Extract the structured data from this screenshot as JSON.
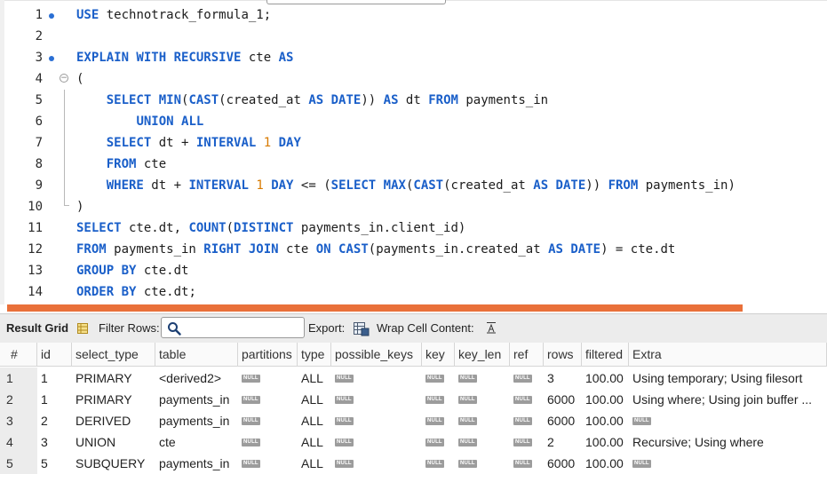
{
  "editor": {
    "lines": [
      {
        "n": "1",
        "dot": true,
        "fold": false,
        "tokens": [
          [
            "kw",
            "USE"
          ],
          [
            "t",
            " technotrack_formula_1;"
          ]
        ]
      },
      {
        "n": "2",
        "dot": false,
        "fold": false,
        "tokens": []
      },
      {
        "n": "3",
        "dot": true,
        "fold": false,
        "tokens": [
          [
            "kw",
            "EXPLAIN WITH RECURSIVE"
          ],
          [
            "t",
            " cte "
          ],
          [
            "kw",
            "AS"
          ]
        ]
      },
      {
        "n": "4",
        "dot": false,
        "fold": true,
        "tokens": [
          [
            "t",
            "("
          ]
        ]
      },
      {
        "n": "5",
        "dot": false,
        "fold": false,
        "tokens": [
          [
            "t",
            "    "
          ],
          [
            "kw",
            "SELECT MIN"
          ],
          [
            "t",
            "("
          ],
          [
            "kw",
            "CAST"
          ],
          [
            "t",
            "(created_at "
          ],
          [
            "kw",
            "AS DATE"
          ],
          [
            "t",
            ")) "
          ],
          [
            "kw",
            "AS"
          ],
          [
            "t",
            " dt "
          ],
          [
            "kw",
            "FROM"
          ],
          [
            "t",
            " payments_in"
          ]
        ]
      },
      {
        "n": "6",
        "dot": false,
        "fold": false,
        "tokens": [
          [
            "t",
            "        "
          ],
          [
            "kw",
            "UNION ALL"
          ]
        ]
      },
      {
        "n": "7",
        "dot": false,
        "fold": false,
        "tokens": [
          [
            "t",
            "    "
          ],
          [
            "kw",
            "SELECT"
          ],
          [
            "t",
            " dt + "
          ],
          [
            "kw",
            "INTERVAL"
          ],
          [
            "t",
            " "
          ],
          [
            "num",
            "1"
          ],
          [
            "t",
            " "
          ],
          [
            "kw",
            "DAY"
          ]
        ]
      },
      {
        "n": "8",
        "dot": false,
        "fold": false,
        "tokens": [
          [
            "t",
            "    "
          ],
          [
            "kw",
            "FROM"
          ],
          [
            "t",
            " cte"
          ]
        ]
      },
      {
        "n": "9",
        "dot": false,
        "fold": false,
        "tokens": [
          [
            "t",
            "    "
          ],
          [
            "kw",
            "WHERE"
          ],
          [
            "t",
            " dt + "
          ],
          [
            "kw",
            "INTERVAL"
          ],
          [
            "t",
            " "
          ],
          [
            "num",
            "1"
          ],
          [
            "t",
            " "
          ],
          [
            "kw",
            "DAY"
          ],
          [
            "t",
            " <= ("
          ],
          [
            "kw",
            "SELECT MAX"
          ],
          [
            "t",
            "("
          ],
          [
            "kw",
            "CAST"
          ],
          [
            "t",
            "(created_at "
          ],
          [
            "kw",
            "AS DATE"
          ],
          [
            "t",
            ")) "
          ],
          [
            "kw",
            "FROM"
          ],
          [
            "t",
            " payments_in)"
          ]
        ]
      },
      {
        "n": "10",
        "dot": false,
        "fold": false,
        "tokens": [
          [
            "t",
            ")"
          ]
        ]
      },
      {
        "n": "11",
        "dot": false,
        "fold": false,
        "tokens": [
          [
            "kw",
            "SELECT"
          ],
          [
            "t",
            " cte.dt, "
          ],
          [
            "kw",
            "COUNT"
          ],
          [
            "t",
            "("
          ],
          [
            "kw",
            "DISTINCT"
          ],
          [
            "t",
            " payments_in.client_id)"
          ]
        ]
      },
      {
        "n": "12",
        "dot": false,
        "fold": false,
        "tokens": [
          [
            "kw",
            "FROM"
          ],
          [
            "t",
            " payments_in "
          ],
          [
            "kw",
            "RIGHT JOIN"
          ],
          [
            "t",
            " cte "
          ],
          [
            "kw",
            "ON CAST"
          ],
          [
            "t",
            "(payments_in.created_at "
          ],
          [
            "kw",
            "AS DATE"
          ],
          [
            "t",
            ") = cte.dt"
          ]
        ]
      },
      {
        "n": "13",
        "dot": false,
        "fold": false,
        "tokens": [
          [
            "kw",
            "GROUP BY"
          ],
          [
            "t",
            " cte.dt"
          ]
        ]
      },
      {
        "n": "14",
        "dot": false,
        "fold": false,
        "tokens": [
          [
            "kw",
            "ORDER BY"
          ],
          [
            "t",
            " cte.dt;"
          ]
        ]
      }
    ]
  },
  "toolbar": {
    "result_grid": "Result Grid",
    "filter_rows": "Filter Rows:",
    "filter_value": "",
    "export": "Export:",
    "wrap_cell": "Wrap Cell Content:"
  },
  "grid": {
    "null_text": "NULL",
    "columns": [
      "#",
      "id",
      "select_type",
      "table",
      "partitions",
      "type",
      "possible_keys",
      "key",
      "key_len",
      "ref",
      "rows",
      "filtered",
      "Extra"
    ],
    "rows": [
      [
        "1",
        "1",
        "PRIMARY",
        "<derived2>",
        null,
        "ALL",
        null,
        null,
        null,
        null,
        "3",
        "100.00",
        "Using temporary; Using filesort"
      ],
      [
        "2",
        "1",
        "PRIMARY",
        "payments_in",
        null,
        "ALL",
        null,
        null,
        null,
        null,
        "6000",
        "100.00",
        "Using where; Using join buffer ..."
      ],
      [
        "3",
        "2",
        "DERIVED",
        "payments_in",
        null,
        "ALL",
        null,
        null,
        null,
        null,
        "6000",
        "100.00",
        null
      ],
      [
        "4",
        "3",
        "UNION",
        "cte",
        null,
        "ALL",
        null,
        null,
        null,
        null,
        "2",
        "100.00",
        "Recursive; Using where"
      ],
      [
        "5",
        "5",
        "SUBQUERY",
        "payments_in",
        null,
        "ALL",
        null,
        null,
        null,
        null,
        "6000",
        "100.00",
        null
      ]
    ]
  },
  "colors": {
    "keyword": "#1a5fc9",
    "number": "#d87a00",
    "accent_bar": "#e9703a",
    "gutter_dot": "#2a6fd4"
  }
}
